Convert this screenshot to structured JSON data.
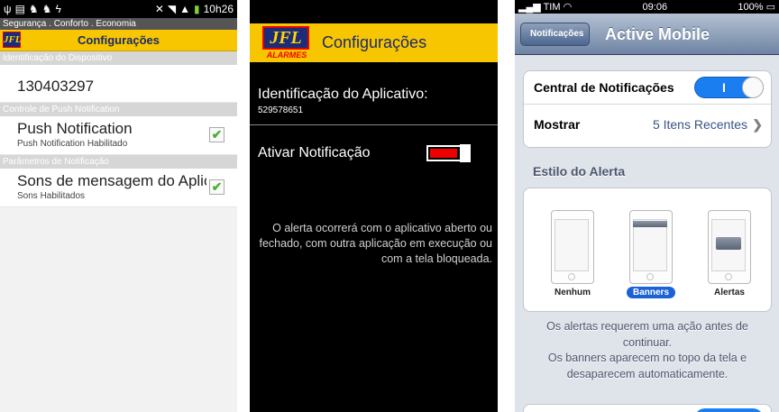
{
  "android": {
    "status": {
      "time": "10h26"
    },
    "tagline": "Segurança . Conforto . Economia",
    "logo_text": "JFL",
    "title": "Configurações",
    "section1": "Identificação do Dispositivo",
    "device_id": "130403297",
    "section2": "Controle de Push Notification",
    "push": {
      "title": "Push Notification",
      "subtitle": "Push Notification Habilitado"
    },
    "section3": "Parâmetros de Notificação",
    "sounds": {
      "title": "Sons de mensagem do Aplicativo",
      "subtitle": "Sons Habilitados"
    }
  },
  "wp": {
    "logo_text": "JFL",
    "logo_sub": "ALARMES",
    "title": "Configurações",
    "id_label": "Identificação do Aplicativo:",
    "id_value": "529578651",
    "toggle_label": "Ativar Notificação",
    "description": "O alerta ocorrerá com o aplicativo aberto ou fechado, com outra aplicação em execução ou com a tela bloqueada."
  },
  "ios": {
    "status": {
      "carrier": "TIM",
      "time": "09:06",
      "battery": "100%"
    },
    "back_label": "Notificações",
    "nav_title": "Active Mobile",
    "central_label": "Central de Notificações",
    "switch_on": "I",
    "mostrar_label": "Mostrar",
    "mostrar_value": "5 Itens Recentes",
    "estilo_header": "Estilo do Alerta",
    "options": [
      "Nenhum",
      "Banners",
      "Alertas"
    ],
    "footer1": "Os alertas requerem uma ação antes de continuar.",
    "footer2": "Os banners aparecem no topo da tela e desaparecem automaticamente."
  }
}
